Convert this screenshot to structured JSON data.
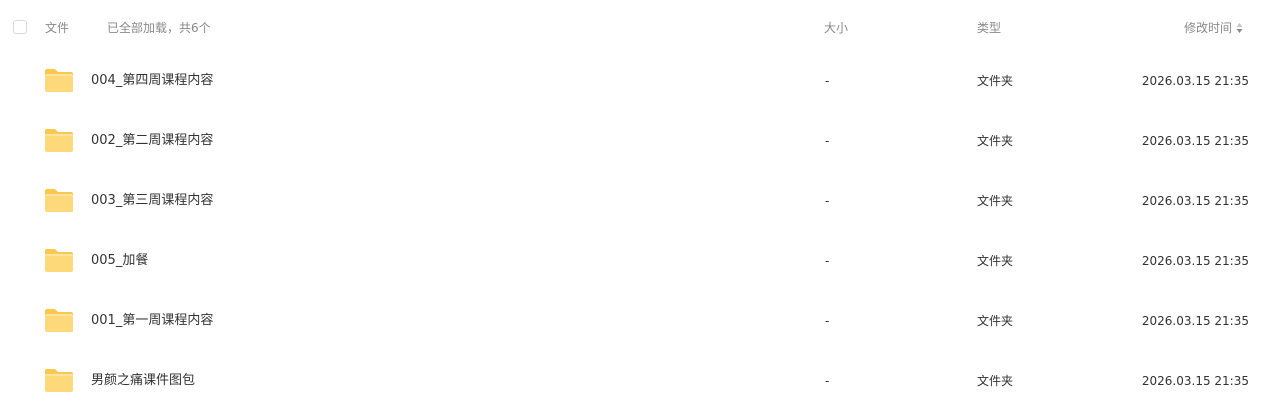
{
  "header": {
    "name_label": "文件",
    "status_text": "已全部加载，共6个",
    "size_label": "大小",
    "type_label": "类型",
    "mtime_label": "修改时间"
  },
  "icons": {
    "folder": "folder-icon",
    "sort": "sort-icon",
    "folder_color": "#fcd76b",
    "folder_color_light": "#fde7a1"
  },
  "rows": [
    {
      "name": "004_第四周课程内容",
      "size": "-",
      "type": "文件夹",
      "mtime": "2026.03.15 21:35"
    },
    {
      "name": "002_第二周课程内容",
      "size": "-",
      "type": "文件夹",
      "mtime": "2026.03.15 21:35"
    },
    {
      "name": "003_第三周课程内容",
      "size": "-",
      "type": "文件夹",
      "mtime": "2026.03.15 21:35"
    },
    {
      "name": "005_加餐",
      "size": "-",
      "type": "文件夹",
      "mtime": "2026.03.15 21:35"
    },
    {
      "name": "001_第一周课程内容",
      "size": "-",
      "type": "文件夹",
      "mtime": "2026.03.15 21:35"
    },
    {
      "name": "男颜之痛课件图包",
      "size": "-",
      "type": "文件夹",
      "mtime": "2026.03.15 21:35"
    }
  ]
}
